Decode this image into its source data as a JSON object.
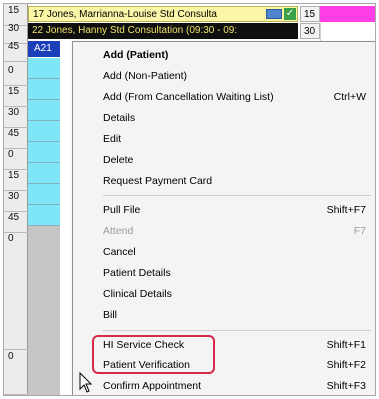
{
  "time_column": [
    "15",
    "30",
    "45",
    "0",
    "15",
    "30",
    "45",
    "0",
    "15",
    "30",
    "45",
    "0",
    "0"
  ],
  "appointments": {
    "row1_text": "17 Jones, Marrianna-Louise     Std Consulta",
    "row2_text": "22 Jones, Hanny      Std Consultation (09:30 - 09:",
    "row3_text": "A21",
    "right_times": [
      "15",
      "30"
    ]
  },
  "menu": {
    "items": [
      {
        "label": "Add (Patient)",
        "shortcut": ""
      },
      {
        "label": "Add (Non-Patient)",
        "shortcut": ""
      },
      {
        "label": "Add (From Cancellation Waiting List)",
        "shortcut": "Ctrl+W"
      },
      {
        "label": "Details",
        "shortcut": ""
      },
      {
        "label": "Edit",
        "shortcut": ""
      },
      {
        "label": "Delete",
        "shortcut": ""
      },
      {
        "label": "Request Payment Card",
        "shortcut": ""
      },
      {
        "label": "Pull File",
        "shortcut": "Shift+F7"
      },
      {
        "label": "Attend",
        "shortcut": "F7"
      },
      {
        "label": "Cancel",
        "shortcut": ""
      },
      {
        "label": "Patient Details",
        "shortcut": ""
      },
      {
        "label": "Clinical Details",
        "shortcut": ""
      },
      {
        "label": "Bill",
        "shortcut": ""
      },
      {
        "label": "HI Service Check",
        "shortcut": "Shift+F1"
      },
      {
        "label": "Patient Verification",
        "shortcut": "Shift+F2"
      },
      {
        "label": "Confirm Appointment",
        "shortcut": "Shift+F3"
      }
    ]
  },
  "colors": {
    "highlight": "#d8294a",
    "appointment_yellow": "#fbf7a8",
    "grid_cyan": "#7fe6f7",
    "magenta": "#ff3fe5"
  }
}
